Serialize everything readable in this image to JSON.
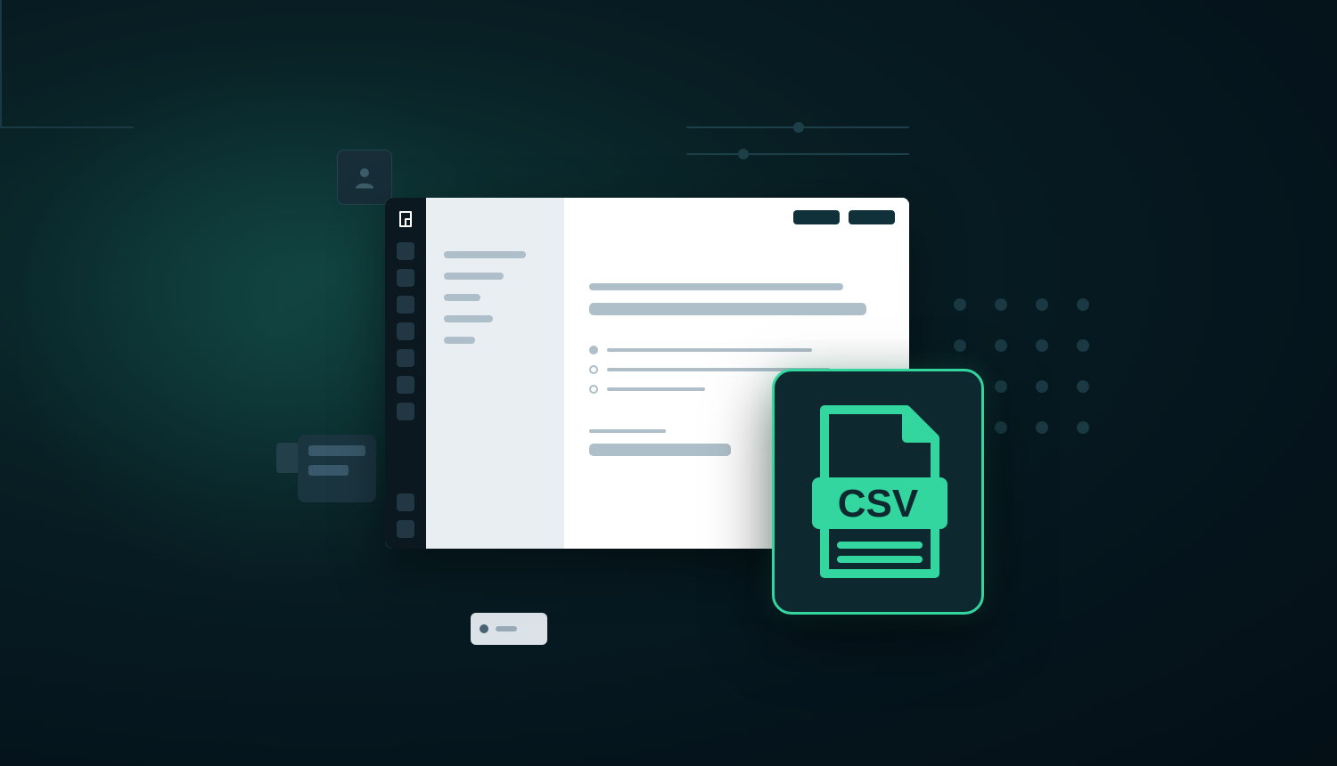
{
  "file_badge": {
    "label": "CSV",
    "icon": "csv-file-icon",
    "accent_color": "#33d69f"
  },
  "decorations": {
    "user_icon": "user-icon",
    "slider_icon": "slider-icon",
    "dot_grid_icon": "dot-grid-icon",
    "card_icon": "card-icon",
    "chip_icon": "chip-icon"
  },
  "window": {
    "logo_icon": "app-logo-icon",
    "topbar_buttons": [
      "",
      ""
    ],
    "nav_items": [
      "",
      "",
      "",
      "",
      "",
      "",
      "",
      "",
      ""
    ]
  }
}
